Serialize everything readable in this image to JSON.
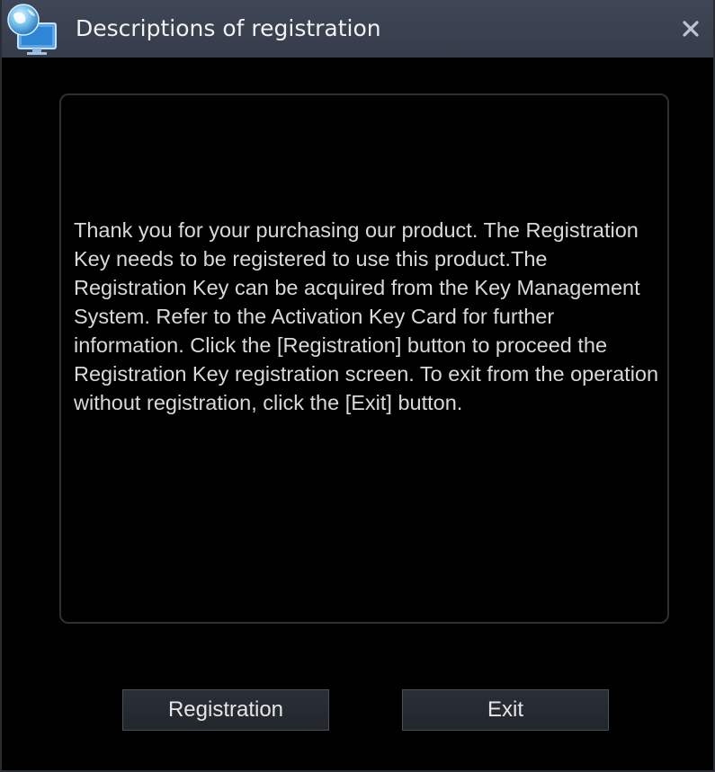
{
  "window": {
    "title": "Descriptions of registration",
    "app_icon": "globe-monitor-icon",
    "close_icon": "close-icon"
  },
  "message": {
    "text": "Thank you for your purchasing our product. The Registration Key needs to be registered to use this product.The Registration Key can be acquired from the Key Management System. Refer to the Activation Key Card for further information. Click the [Registration] button to proceed the Registration Key registration screen. To exit from the operation without registration, click the [Exit] button."
  },
  "buttons": {
    "registration_label": "Registration",
    "exit_label": "Exit"
  },
  "colors": {
    "titlebar": "#3b4150",
    "background": "#000000",
    "text": "#d9d9d9",
    "button_border": "#4a4f59"
  }
}
